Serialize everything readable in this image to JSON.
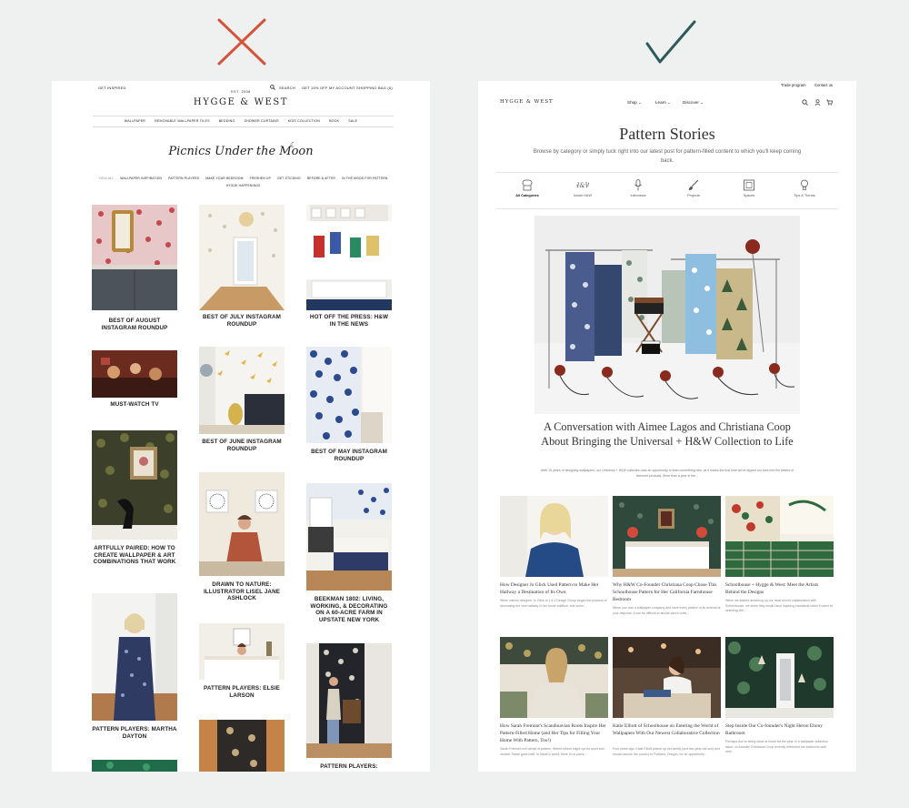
{
  "markers": {
    "bad_color": "#d4533a",
    "good_color": "#2e5a5a"
  },
  "left_page": {
    "topbar": {
      "inspired": "GET INSPIRED",
      "search": "SEARCH",
      "offer": "GET 15% OFF",
      "account": "MY ACCOUNT",
      "bag": "SHOPPING BAG (0)"
    },
    "est": "EST. 2008",
    "logo": "HYGGE & WEST",
    "nav": [
      "WALLPAPER",
      "REMOVABLE WALLPAPER TILES",
      "BEDDING",
      "SHOWER CURTAINS",
      "KIDS COLLECTION",
      "BOOK",
      "SALE"
    ],
    "hero_title": "Picnics Under the Moon",
    "categories": [
      "VIEW ALL",
      "WALLPAPER INSPIRATION",
      "PATTERN PLAYERS",
      "MAKE YOUR BEDROOM",
      "FRESHEN UP",
      "GET STICKING",
      "BEFORE & AFTER",
      "IN THE MOOD FOR PATTERN",
      "HYGGE HAPPENINGS"
    ],
    "posts": [
      {
        "caption": "BEST OF AUGUST INSTAGRAM ROUNDUP"
      },
      {
        "caption": "MUST-WATCH TV"
      },
      {
        "caption": "ARTFULLY PAIRED: HOW TO CREATE WALLPAPER & ART COMBINATIONS THAT WORK"
      },
      {
        "caption": "PATTERN PLAYERS: MARTHA DAYTON"
      },
      {
        "caption": "BEST OF JULY INSTAGRAM ROUNDUP"
      },
      {
        "caption": "BEST OF JUNE INSTAGRAM ROUNDUP"
      },
      {
        "caption": "DRAWN TO NATURE: ILLUSTRATOR LISEL JANE ASHLOCK"
      },
      {
        "caption": "PATTERN PLAYERS: ELSIE LARSON"
      },
      {
        "caption": "HOT OFF THE PRESS: H&W IN THE NEWS"
      },
      {
        "caption": "BEST OF MAY INSTAGRAM ROUNDUP"
      },
      {
        "caption": "BEEKMAN 1802: LIVING, WORKING, & DECORATING ON A 60-ACRE FARM IN UPSTATE NEW YORK"
      },
      {
        "caption": "PATTERN PLAYERS:"
      }
    ]
  },
  "right_page": {
    "utility": {
      "trade": "Trade program",
      "contact": "Contact us"
    },
    "logo": "HYGGE & WEST",
    "nav": [
      "Shop",
      "Learn",
      "Discover"
    ],
    "title": "Pattern Stories",
    "subtitle": "Browse by category or simply tuck right into our latest post for pattern-filled content to which you'll keep coming back.",
    "categories": [
      {
        "label": "All Categories",
        "icon": "wallpaper-roll-icon"
      },
      {
        "label": "Inside H&W",
        "icon": "hw-monogram-icon"
      },
      {
        "label": "Interviews",
        "icon": "microphone-icon"
      },
      {
        "label": "Projects",
        "icon": "brush-icon"
      },
      {
        "label": "Spaces",
        "icon": "frame-icon"
      },
      {
        "label": "Tips & Trends",
        "icon": "lightbulb-icon"
      }
    ],
    "feature": {
      "title": "A Conversation with Aimee Lagos and Christiana Coop About Bringing the Universal + H&W Collection to Life",
      "excerpt": "After 15 years of designing wallpapers, our Universal + H&W collection was an opportunity to learn something new, as it marks the first time we've dipped our toes into the waters of licensed products. More than a year in the..."
    },
    "posts": [
      {
        "title": "How Designer Jo Glick Used Pattern to Make Her Hallway a Destination of Its Own",
        "excerpt": "When interior designer Jo Glick of J & J Design Group began the process of decorating the new hallway in her home addition, she knew..."
      },
      {
        "title": "Why H&W Co-Founder Christiana Coop Chose This Schoolhouse Pattern for Her California Farmhouse Bedroom",
        "excerpt": "When you own a wallpaper company and have every pattern in its arsenal at your disposal, it can be difficult to decide which ones..."
      },
      {
        "title": "Schoolhouse + Hygge & West: Meet the Artists Behind the Designs",
        "excerpt": "When we started dreaming up our most recent collaboration with Schoolhouse, we knew they would have inspiring standards when it came to selecting the..."
      },
      {
        "title": "How Sarah Fremont's Scandinavian Roots Inspire Her Pattern-Filled Home (and Her Tips for Filling Your Home With Pattern, Too!)",
        "excerpt": "Sarah Fremont isn't afraid of pattern. Where others might opt for quiet and neutral, Sarah goes bold. In Sarah's world, there is no place..."
      },
      {
        "title": "Katie Elliott of Schoolhouse on Entering the World of Wallpapers With Our Newest Collaborative Collection",
        "excerpt": "Four years ago, Katie Elliott picked up her family (and two-year-old son) and moved across the country to Portland, Oregon, for an opportunity..."
      },
      {
        "title": "Step Inside Our Co-founder's Night Heron Ebony Bathroom",
        "excerpt": "Perhaps due to being stuck at home for the year or a wallpaper addiction issue, co-founder Christiana Coop recently refreshed her bathroom with new..."
      }
    ]
  }
}
